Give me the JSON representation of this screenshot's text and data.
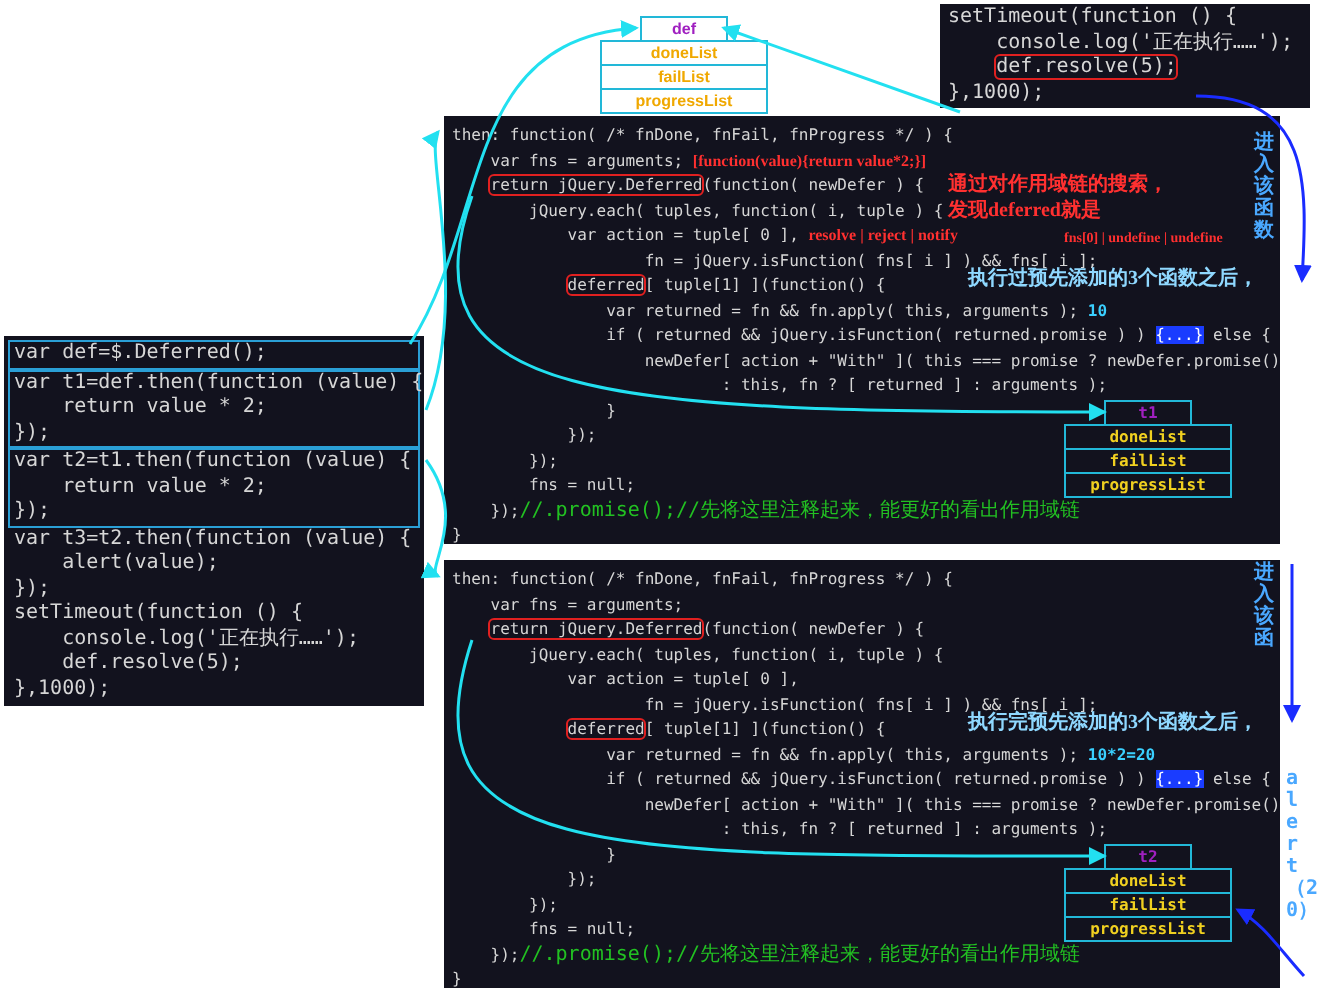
{
  "def_box": {
    "title": "def",
    "rows": [
      "doneList",
      "failList",
      "progressList"
    ]
  },
  "timeout_panel": {
    "lines": [
      "setTimeout(function () {",
      "    console.log('正在执行……');",
      [
        {
          "text": "    def.resolve(5);",
          "kind": "boxed"
        }
      ],
      "},1000);"
    ]
  },
  "caller_panel": {
    "blocks": [
      {
        "framed": true,
        "lines": [
          "var def=$.Deferred();"
        ]
      },
      {
        "framed": true,
        "lines": [
          "var t1=def.then(function (value) {",
          "    return value * 2;",
          "});"
        ]
      },
      {
        "framed": true,
        "lines": [
          "var t2=t1.then(function (value) {",
          "    return value * 2;",
          "});"
        ]
      },
      {
        "framed": false,
        "lines": [
          "var t3=t2.then(function (value) {",
          "    alert(value);",
          "});",
          "setTimeout(function () {",
          "    console.log('正在执行……');",
          "    def.resolve(5);",
          "},1000);"
        ]
      }
    ]
  },
  "then_panels": [
    {
      "lines": [
        "then: function( /* fnDone, fnFail, fnProgress */ ) {",
        [
          {
            "text": "    var fns = arguments; ",
            "kind": "code"
          },
          {
            "text": "[function(value){return value*2;}]",
            "kind": "note"
          }
        ],
        [
          {
            "text": "    return jQuery.Deferred",
            "kind": "boxed"
          },
          {
            "text": "(function( newDefer ) {",
            "kind": "code"
          }
        ],
        "        jQuery.each( tuples, function( i, tuple ) {",
        [
          {
            "text": "            var action = tuple[ 0 ], ",
            "kind": "code"
          },
          {
            "text": "resolve | reject | notify",
            "kind": "note"
          }
        ],
        "                    fn = jQuery.isFunction( fns[ i ] ) && fns[ i ];",
        [
          {
            "text": "            deferred",
            "kind": "boxed"
          },
          {
            "text": "[ tuple[1] ](function() {",
            "kind": "code"
          }
        ],
        [
          {
            "text": "                var returned = fn && fn.apply( this, arguments ); ",
            "kind": "code"
          },
          {
            "text": "10",
            "kind": "value"
          }
        ],
        [
          {
            "text": "                if ( returned && jQuery.isFunction( returned.promise ) ) ",
            "kind": "code"
          },
          {
            "text": "{...}",
            "kind": "collapsed"
          },
          {
            "text": " else {",
            "kind": "code"
          }
        ],
        "                    newDefer[ action + \"With\" ]( this === promise ? newDefer.promise()",
        "                            : this, fn ? [ returned ] : arguments );",
        "                }",
        "            });",
        "        });",
        "        fns = null;",
        [
          {
            "text": "    });",
            "kind": "code"
          },
          {
            "text": "//.promise();//先将这里注释起来，能更好的看出作用域链",
            "kind": "comment"
          }
        ],
        "}"
      ],
      "notes": [
        {
          "kind": "annotation",
          "lines": [
            "通过对作用域链的搜索，",
            "发现deferred就是"
          ]
        },
        {
          "kind": "annotation",
          "lines": [
            "fns[0] | undefine | undefine"
          ]
        },
        {
          "kind": "caption",
          "lines": [
            "执行过预先添加的3个函数之后，"
          ]
        },
        {
          "kind": "vertical",
          "lines": [
            "进入该函数"
          ]
        }
      ],
      "list_box": {
        "title": "t1",
        "rows": [
          "doneList",
          "failList",
          "progressList"
        ]
      }
    },
    {
      "lines": [
        "then: function( /* fnDone, fnFail, fnProgress */ ) {",
        "    var fns = arguments;",
        [
          {
            "text": "    return jQuery.Deferred",
            "kind": "boxed"
          },
          {
            "text": "(function( newDefer ) {",
            "kind": "code"
          }
        ],
        "        jQuery.each( tuples, function( i, tuple ) {",
        "            var action = tuple[ 0 ],",
        "                    fn = jQuery.isFunction( fns[ i ] ) && fns[ i ];",
        [
          {
            "text": "            deferred",
            "kind": "boxed"
          },
          {
            "text": "[ tuple[1] ](function() {",
            "kind": "code"
          }
        ],
        [
          {
            "text": "                var returned = fn && fn.apply( this, arguments ); ",
            "kind": "code"
          },
          {
            "text": "10*2=20",
            "kind": "value"
          }
        ],
        [
          {
            "text": "                if ( returned && jQuery.isFunction( returned.promise ) ) ",
            "kind": "code"
          },
          {
            "text": "{...}",
            "kind": "collapsed"
          },
          {
            "text": " else {",
            "kind": "code"
          }
        ],
        "                    newDefer[ action + \"With\" ]( this === promise ? newDefer.promise()",
        "                            : this, fn ? [ returned ] : arguments );",
        "                }",
        "            });",
        "        });",
        "        fns = null;",
        [
          {
            "text": "    });",
            "kind": "code"
          },
          {
            "text": "//.promise();//先将这里注释起来，能更好的看出作用域链",
            "kind": "comment"
          }
        ],
        "}"
      ],
      "notes": [
        {
          "kind": "caption",
          "lines": [
            "执行完预先添加的3个函数之后，"
          ]
        },
        {
          "kind": "vertical",
          "lines": [
            "进入该函"
          ]
        },
        {
          "kind": "vertical",
          "lines": [
            "alert（20）"
          ]
        }
      ],
      "list_box": {
        "title": "t2",
        "rows": [
          "doneList",
          "failList",
          "progressList"
        ]
      }
    }
  ]
}
